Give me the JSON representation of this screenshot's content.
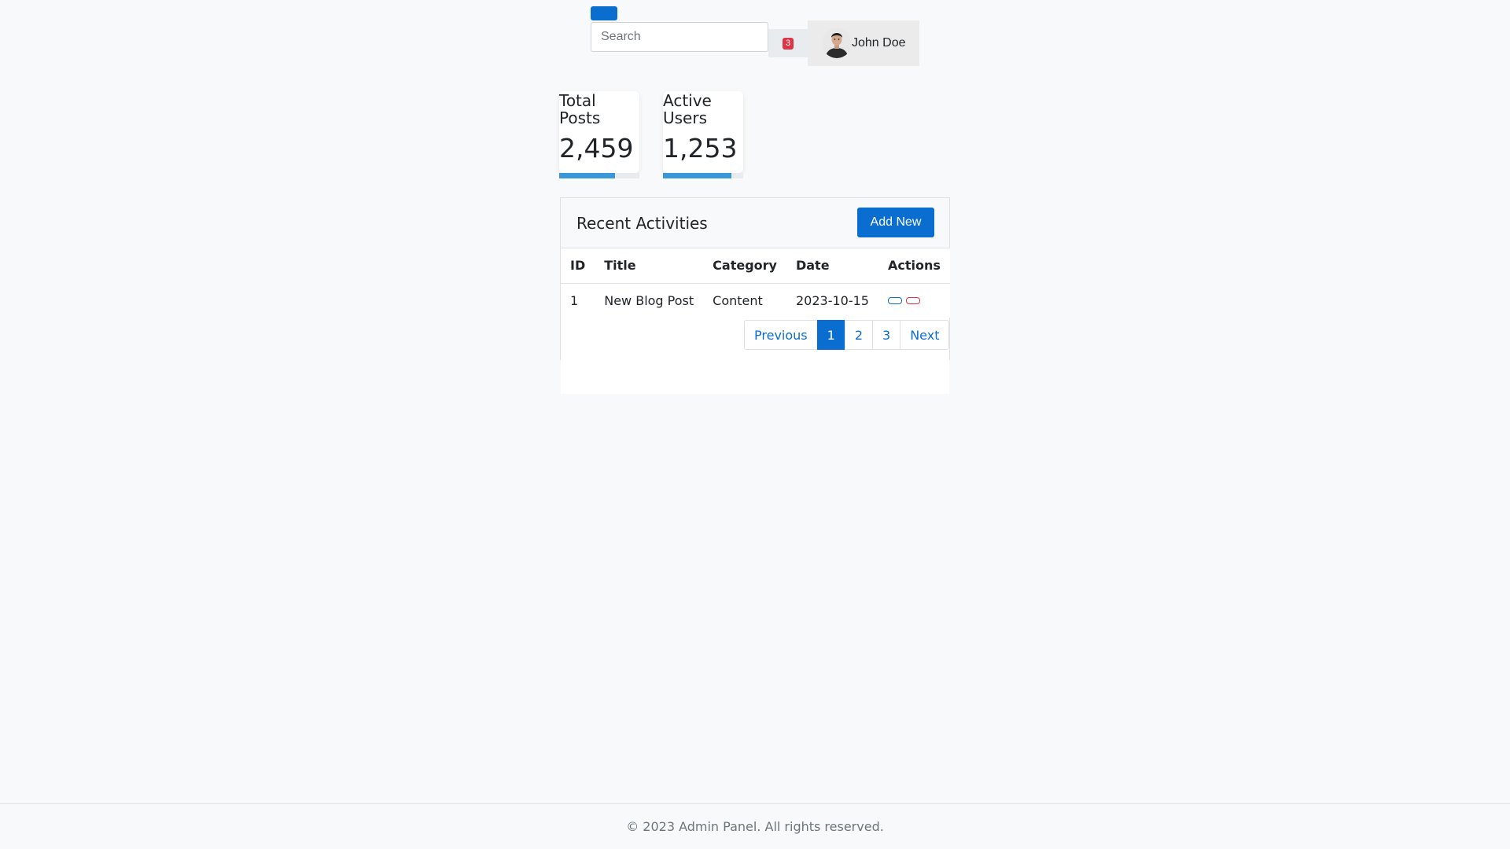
{
  "header": {
    "search_placeholder": "Search",
    "notification_count": "3",
    "user_name": "John Doe"
  },
  "stats": [
    {
      "label": "Total Posts",
      "value": "2,459",
      "progress": 0.7
    },
    {
      "label": "Active Users",
      "value": "1,253",
      "progress": 0.85
    }
  ],
  "activities": {
    "title": "Recent Activities",
    "add_label": "Add New",
    "columns": [
      "ID",
      "Title",
      "Category",
      "Date",
      "Actions"
    ],
    "rows": [
      {
        "id": "1",
        "title": "New Blog Post",
        "category": "Content",
        "date": "2023-10-15"
      }
    ],
    "pagination": {
      "previous": "Previous",
      "pages": [
        "1",
        "2",
        "3"
      ],
      "next": "Next",
      "current_page": "1"
    }
  },
  "footer": {
    "copyright": "© 2023 Admin Panel. All rights reserved."
  },
  "colors": {
    "primary": "#0a6ed1",
    "danger": "#dc3545",
    "progress": "#3a97d8",
    "background": "#f8f9fa"
  }
}
